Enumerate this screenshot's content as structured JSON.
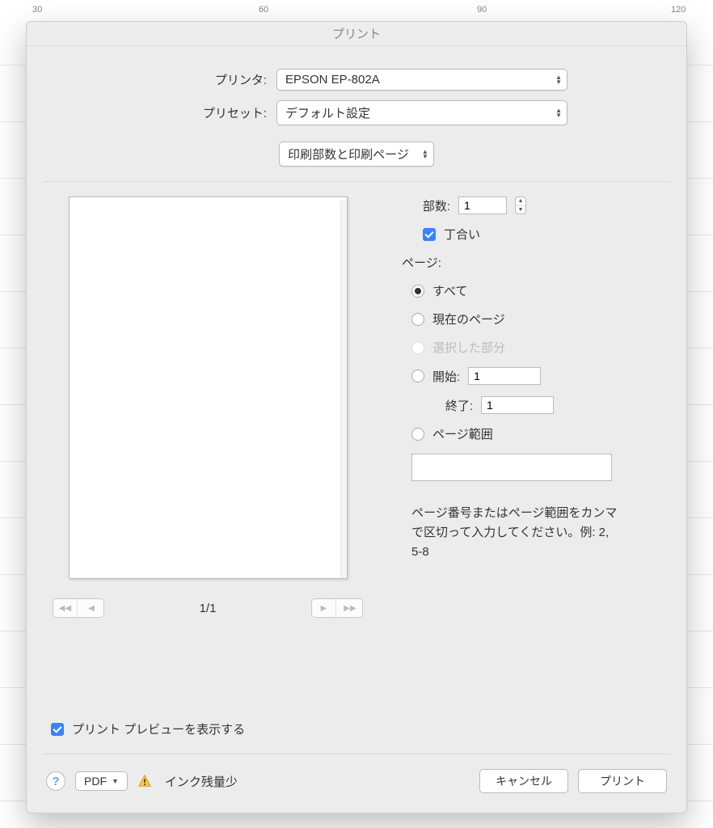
{
  "ruler": {
    "m30": "30",
    "m60": "60",
    "m90": "90",
    "m120": "120"
  },
  "dialog": {
    "title": "プリント",
    "printer_label": "プリンタ:",
    "printer_value": "EPSON EP-802A",
    "preset_label": "プリセット:",
    "preset_value": "デフォルト設定",
    "section_select": "印刷部数と印刷ページ"
  },
  "opts": {
    "copies_label": "部数:",
    "copies_value": "1",
    "collate_label": "丁合い",
    "collate_checked": true,
    "pages_label": "ページ:",
    "radio_all": "すべて",
    "radio_current": "現在のページ",
    "radio_selection": "選択した部分",
    "radio_from": "開始:",
    "from_value": "1",
    "to_label": "終了:",
    "to_value": "1",
    "radio_range": "ページ範囲",
    "range_value": "",
    "note": "ページ番号またはページ範囲をカンマで区切って入力してください。例: 2, 5-8"
  },
  "pager": {
    "page_indicator": "1/1"
  },
  "show_preview": {
    "checked": true,
    "label": "プリント プレビューを表示する"
  },
  "footer": {
    "pdf_label": "PDF",
    "ink_warning": "インク残量少",
    "cancel": "キャンセル",
    "print": "プリント"
  }
}
